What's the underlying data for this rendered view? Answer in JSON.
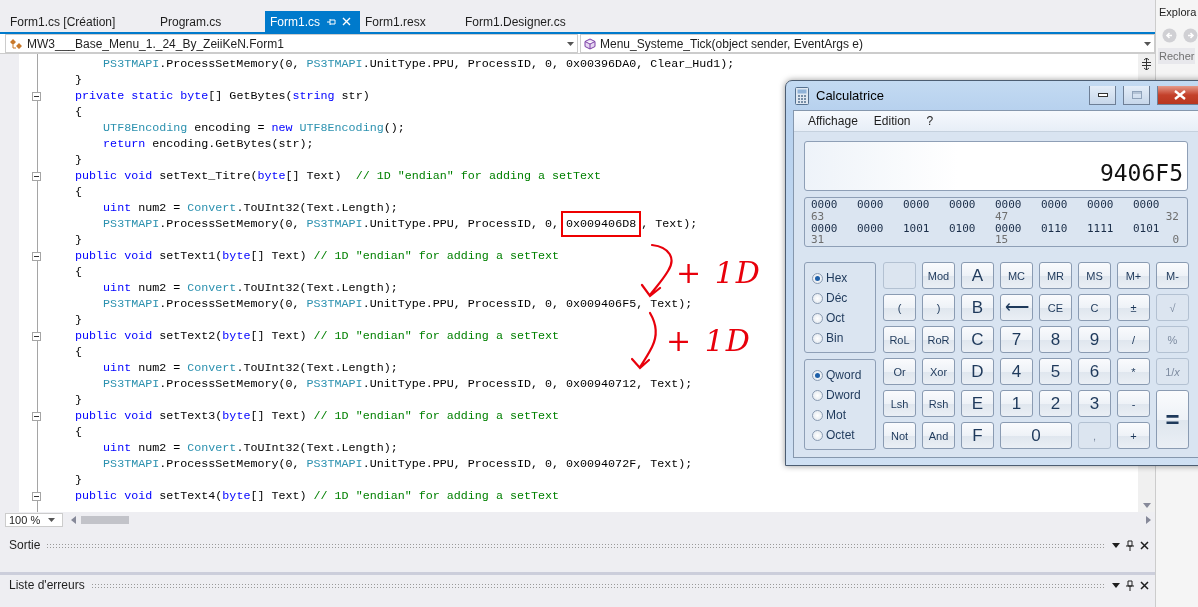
{
  "tabs": [
    {
      "label": "Form1.cs [Création]",
      "selected": false
    },
    {
      "label": "Program.cs",
      "selected": false
    },
    {
      "label": "Form1.cs",
      "selected": true
    },
    {
      "label": "Form1.resx",
      "selected": false
    },
    {
      "label": "Form1.Designer.cs",
      "selected": false
    }
  ],
  "nav_bar": {
    "class_dropdown": "MW3___Base_Menu_1._24_By_ZeiiKeN.Form1",
    "member_dropdown": "Menu_Systeme_Tick(object sender, EventArgs e)"
  },
  "editor": {
    "lines": [
      {
        "fold": false,
        "tokens": [
          {
            "kind": "type",
            "text": "        PS3TMAPI"
          },
          {
            "kind": "plain",
            "text": ".ProcessSetMemory(0, "
          },
          {
            "kind": "type",
            "text": "PS3TMAPI"
          },
          {
            "kind": "plain",
            "text": ".UnitType.PPU, ProcessID, 0, 0x00396DA0, Clear_Hud1);"
          }
        ]
      },
      {
        "fold": false,
        "tokens": [
          {
            "kind": "plain",
            "text": "    }"
          }
        ]
      },
      {
        "fold": true,
        "tokens": [
          {
            "kind": "keyword",
            "text": "    private static byte"
          },
          {
            "kind": "plain",
            "text": "[] GetBytes("
          },
          {
            "kind": "keyword",
            "text": "string"
          },
          {
            "kind": "plain",
            "text": " str)"
          }
        ]
      },
      {
        "fold": false,
        "tokens": [
          {
            "kind": "plain",
            "text": "    {"
          }
        ]
      },
      {
        "fold": false,
        "tokens": [
          {
            "kind": "type",
            "text": "        UTF8Encoding"
          },
          {
            "kind": "plain",
            "text": " encoding = "
          },
          {
            "kind": "keyword",
            "text": "new "
          },
          {
            "kind": "type",
            "text": "UTF8Encoding"
          },
          {
            "kind": "plain",
            "text": "();"
          }
        ]
      },
      {
        "fold": false,
        "tokens": [
          {
            "kind": "keyword",
            "text": "        return"
          },
          {
            "kind": "plain",
            "text": " encoding.GetBytes(str);"
          }
        ]
      },
      {
        "fold": false,
        "tokens": [
          {
            "kind": "plain",
            "text": "    }"
          }
        ]
      },
      {
        "fold": true,
        "tokens": [
          {
            "kind": "keyword",
            "text": "    public void"
          },
          {
            "kind": "plain",
            "text": " setText_Titre("
          },
          {
            "kind": "keyword",
            "text": "byte"
          },
          {
            "kind": "plain",
            "text": "[] Text)  "
          },
          {
            "kind": "comment",
            "text": "// 1D \"endian\" for adding a setText"
          }
        ]
      },
      {
        "fold": false,
        "tokens": [
          {
            "kind": "plain",
            "text": "    {"
          }
        ]
      },
      {
        "fold": false,
        "tokens": [
          {
            "kind": "keyword",
            "text": "        uint"
          },
          {
            "kind": "plain",
            "text": " num2 = "
          },
          {
            "kind": "type",
            "text": "Convert"
          },
          {
            "kind": "plain",
            "text": ".ToUInt32(Text.Length);"
          }
        ]
      },
      {
        "fold": false,
        "tokens": [
          {
            "kind": "type",
            "text": "        PS3TMAPI"
          },
          {
            "kind": "plain",
            "text": ".ProcessSetMemory(0, "
          },
          {
            "kind": "type",
            "text": "PS3TMAPI"
          },
          {
            "kind": "plain",
            "text": ".UnitType.PPU, ProcessID, 0, "
          },
          {
            "kind": "boxed",
            "text": "0x009406D8"
          },
          {
            "kind": "plain",
            "text": ", Text);"
          }
        ]
      },
      {
        "fold": false,
        "tokens": [
          {
            "kind": "plain",
            "text": "    }"
          }
        ]
      },
      {
        "fold": true,
        "tokens": [
          {
            "kind": "keyword",
            "text": "    public void"
          },
          {
            "kind": "plain",
            "text": " setText1("
          },
          {
            "kind": "keyword",
            "text": "byte"
          },
          {
            "kind": "plain",
            "text": "[] Text) "
          },
          {
            "kind": "comment",
            "text": "// 1D \"endian\" for adding a setText"
          }
        ]
      },
      {
        "fold": false,
        "tokens": [
          {
            "kind": "plain",
            "text": "    {"
          }
        ]
      },
      {
        "fold": false,
        "tokens": [
          {
            "kind": "keyword",
            "text": "        uint"
          },
          {
            "kind": "plain",
            "text": " num2 = "
          },
          {
            "kind": "type",
            "text": "Convert"
          },
          {
            "kind": "plain",
            "text": ".ToUInt32(Text.Length);"
          }
        ]
      },
      {
        "fold": false,
        "tokens": [
          {
            "kind": "type",
            "text": "        PS3TMAPI"
          },
          {
            "kind": "plain",
            "text": ".ProcessSetMemory(0, "
          },
          {
            "kind": "type",
            "text": "PS3TMAPI"
          },
          {
            "kind": "plain",
            "text": ".UnitType.PPU, ProcessID, 0, 0x009406F5, Text);"
          }
        ]
      },
      {
        "fold": false,
        "tokens": [
          {
            "kind": "plain",
            "text": "    }"
          }
        ]
      },
      {
        "fold": true,
        "tokens": [
          {
            "kind": "keyword",
            "text": "    public void"
          },
          {
            "kind": "plain",
            "text": " setText2("
          },
          {
            "kind": "keyword",
            "text": "byte"
          },
          {
            "kind": "plain",
            "text": "[] Text) "
          },
          {
            "kind": "comment",
            "text": "// 1D \"endian\" for adding a setText"
          }
        ]
      },
      {
        "fold": false,
        "tokens": [
          {
            "kind": "plain",
            "text": "    {"
          }
        ]
      },
      {
        "fold": false,
        "tokens": [
          {
            "kind": "keyword",
            "text": "        uint"
          },
          {
            "kind": "plain",
            "text": " num2 = "
          },
          {
            "kind": "type",
            "text": "Convert"
          },
          {
            "kind": "plain",
            "text": ".ToUInt32(Text.Length);"
          }
        ]
      },
      {
        "fold": false,
        "tokens": [
          {
            "kind": "type",
            "text": "        PS3TMAPI"
          },
          {
            "kind": "plain",
            "text": ".ProcessSetMemory(0, "
          },
          {
            "kind": "type",
            "text": "PS3TMAPI"
          },
          {
            "kind": "plain",
            "text": ".UnitType.PPU, ProcessID, 0, 0x00940712, Text);"
          }
        ]
      },
      {
        "fold": false,
        "tokens": [
          {
            "kind": "plain",
            "text": "    }"
          }
        ]
      },
      {
        "fold": true,
        "tokens": [
          {
            "kind": "keyword",
            "text": "    public void"
          },
          {
            "kind": "plain",
            "text": " setText3("
          },
          {
            "kind": "keyword",
            "text": "byte"
          },
          {
            "kind": "plain",
            "text": "[] Text) "
          },
          {
            "kind": "comment",
            "text": "// 1D \"endian\" for adding a setText"
          }
        ]
      },
      {
        "fold": false,
        "tokens": [
          {
            "kind": "plain",
            "text": "    {"
          }
        ]
      },
      {
        "fold": false,
        "tokens": [
          {
            "kind": "keyword",
            "text": "        uint"
          },
          {
            "kind": "plain",
            "text": " num2 = "
          },
          {
            "kind": "type",
            "text": "Convert"
          },
          {
            "kind": "plain",
            "text": ".ToUInt32(Text.Length);"
          }
        ]
      },
      {
        "fold": false,
        "tokens": [
          {
            "kind": "type",
            "text": "        PS3TMAPI"
          },
          {
            "kind": "plain",
            "text": ".ProcessSetMemory(0, "
          },
          {
            "kind": "type",
            "text": "PS3TMAPI"
          },
          {
            "kind": "plain",
            "text": ".UnitType.PPU, ProcessID, 0, 0x0094072F, Text);"
          }
        ]
      },
      {
        "fold": false,
        "tokens": [
          {
            "kind": "plain",
            "text": "    }"
          }
        ]
      },
      {
        "fold": true,
        "tokens": [
          {
            "kind": "keyword",
            "text": "    public void"
          },
          {
            "kind": "plain",
            "text": " setText4("
          },
          {
            "kind": "keyword",
            "text": "byte"
          },
          {
            "kind": "plain",
            "text": "[] Text) "
          },
          {
            "kind": "comment",
            "text": "// 1D \"endian\" for adding a setText"
          }
        ]
      }
    ],
    "annotations": [
      {
        "text": "+ 1D"
      },
      {
        "text": "+ 1D"
      }
    ],
    "zoom": "100 %"
  },
  "side_panel": {
    "title": "Explora",
    "search": "Recher"
  },
  "panels": [
    {
      "title": "Sortie"
    },
    {
      "title": "Liste d'erreurs"
    }
  ],
  "calculator": {
    "title": "Calculatrice",
    "menu": [
      "Affichage",
      "Edition",
      "?"
    ],
    "display": "9406F5",
    "bits": [
      {
        "groups": [
          "0000",
          "0000",
          "0000",
          "0000",
          "0000",
          "0000",
          "0000",
          "0000"
        ],
        "labels": [
          "63",
          "47",
          "32"
        ]
      },
      {
        "groups": [
          "0000",
          "0000",
          "1001",
          "0100",
          "0000",
          "0110",
          "1111",
          "0101"
        ],
        "labels": [
          "31",
          "15",
          "0"
        ]
      }
    ],
    "base": [
      {
        "label": "Hex",
        "selected": true
      },
      {
        "label": "Déc",
        "selected": false
      },
      {
        "label": "Oct",
        "selected": false
      },
      {
        "label": "Bin",
        "selected": false
      }
    ],
    "word_size": [
      {
        "label": "Qword",
        "selected": true
      },
      {
        "label": "Dword",
        "selected": false
      },
      {
        "label": "Mot",
        "selected": false
      },
      {
        "label": "Octet",
        "selected": false
      }
    ],
    "keys": [
      {
        "kind": "key",
        "disabled": true
      },
      {
        "kind": "key",
        "label": "Mod",
        "disabled": false
      },
      {
        "kind": "digit",
        "label": "A",
        "disabled": false
      },
      {
        "kind": "key",
        "label": "MC",
        "disabled": false
      },
      {
        "kind": "key",
        "label": "MR",
        "disabled": false
      },
      {
        "kind": "key",
        "label": "MS",
        "disabled": false
      },
      {
        "kind": "key",
        "label": "M+",
        "disabled": false
      },
      {
        "kind": "key",
        "label": "M-",
        "disabled": false
      },
      {
        "kind": "key",
        "label": "(",
        "disabled": false
      },
      {
        "kind": "key",
        "label": ")",
        "disabled": false
      },
      {
        "kind": "digit",
        "label": "B",
        "disabled": false
      },
      {
        "kind": "digit",
        "label": "⟵",
        "disabled": false
      },
      {
        "kind": "key",
        "label": "CE",
        "disabled": false
      },
      {
        "kind": "key",
        "label": "C",
        "disabled": false
      },
      {
        "kind": "key",
        "label": "±",
        "disabled": false
      },
      {
        "kind": "key",
        "label": "√",
        "disabled": true
      },
      {
        "kind": "key",
        "label": "RoL",
        "disabled": false
      },
      {
        "kind": "key",
        "label": "RoR",
        "disabled": false
      },
      {
        "kind": "digit",
        "label": "C",
        "disabled": false
      },
      {
        "kind": "digit",
        "label": "7",
        "disabled": false
      },
      {
        "kind": "digit",
        "label": "8",
        "disabled": false
      },
      {
        "kind": "digit",
        "label": "9",
        "disabled": false
      },
      {
        "kind": "key",
        "label": "/",
        "disabled": false
      },
      {
        "kind": "key",
        "label": "%",
        "disabled": true
      },
      {
        "kind": "key",
        "label": "Or",
        "disabled": false
      },
      {
        "kind": "key",
        "label": "Xor",
        "disabled": false
      },
      {
        "kind": "digit",
        "label": "D",
        "disabled": false
      },
      {
        "kind": "digit",
        "label": "4",
        "disabled": false
      },
      {
        "kind": "digit",
        "label": "5",
        "disabled": false
      },
      {
        "kind": "digit",
        "label": "6",
        "disabled": false
      },
      {
        "kind": "key",
        "label": "*",
        "disabled": false
      },
      {
        "kind": "key",
        "label": "1/*x*",
        "disabled": true
      },
      {
        "kind": "key",
        "label": "Lsh",
        "disabled": false
      },
      {
        "kind": "key",
        "label": "Rsh",
        "disabled": false
      },
      {
        "kind": "digit",
        "label": "E",
        "disabled": false
      },
      {
        "kind": "digit",
        "label": "1",
        "disabled": false
      },
      {
        "kind": "digit",
        "label": "2",
        "disabled": false
      },
      {
        "kind": "digit",
        "label": "3",
        "disabled": false
      },
      {
        "kind": "key",
        "label": "-",
        "disabled": false
      },
      {
        "kind": "tall",
        "label": "=",
        "disabled": false
      },
      {
        "kind": "key",
        "label": "Not",
        "disabled": false
      },
      {
        "kind": "key",
        "label": "And",
        "disabled": false
      },
      {
        "kind": "digit",
        "label": "F",
        "disabled": false
      },
      {
        "kind": "wide",
        "label": "0",
        "disabled": false
      },
      {
        "kind": "key",
        "label": ",",
        "disabled": true
      },
      {
        "kind": "key",
        "label": "+",
        "disabled": false
      }
    ]
  }
}
